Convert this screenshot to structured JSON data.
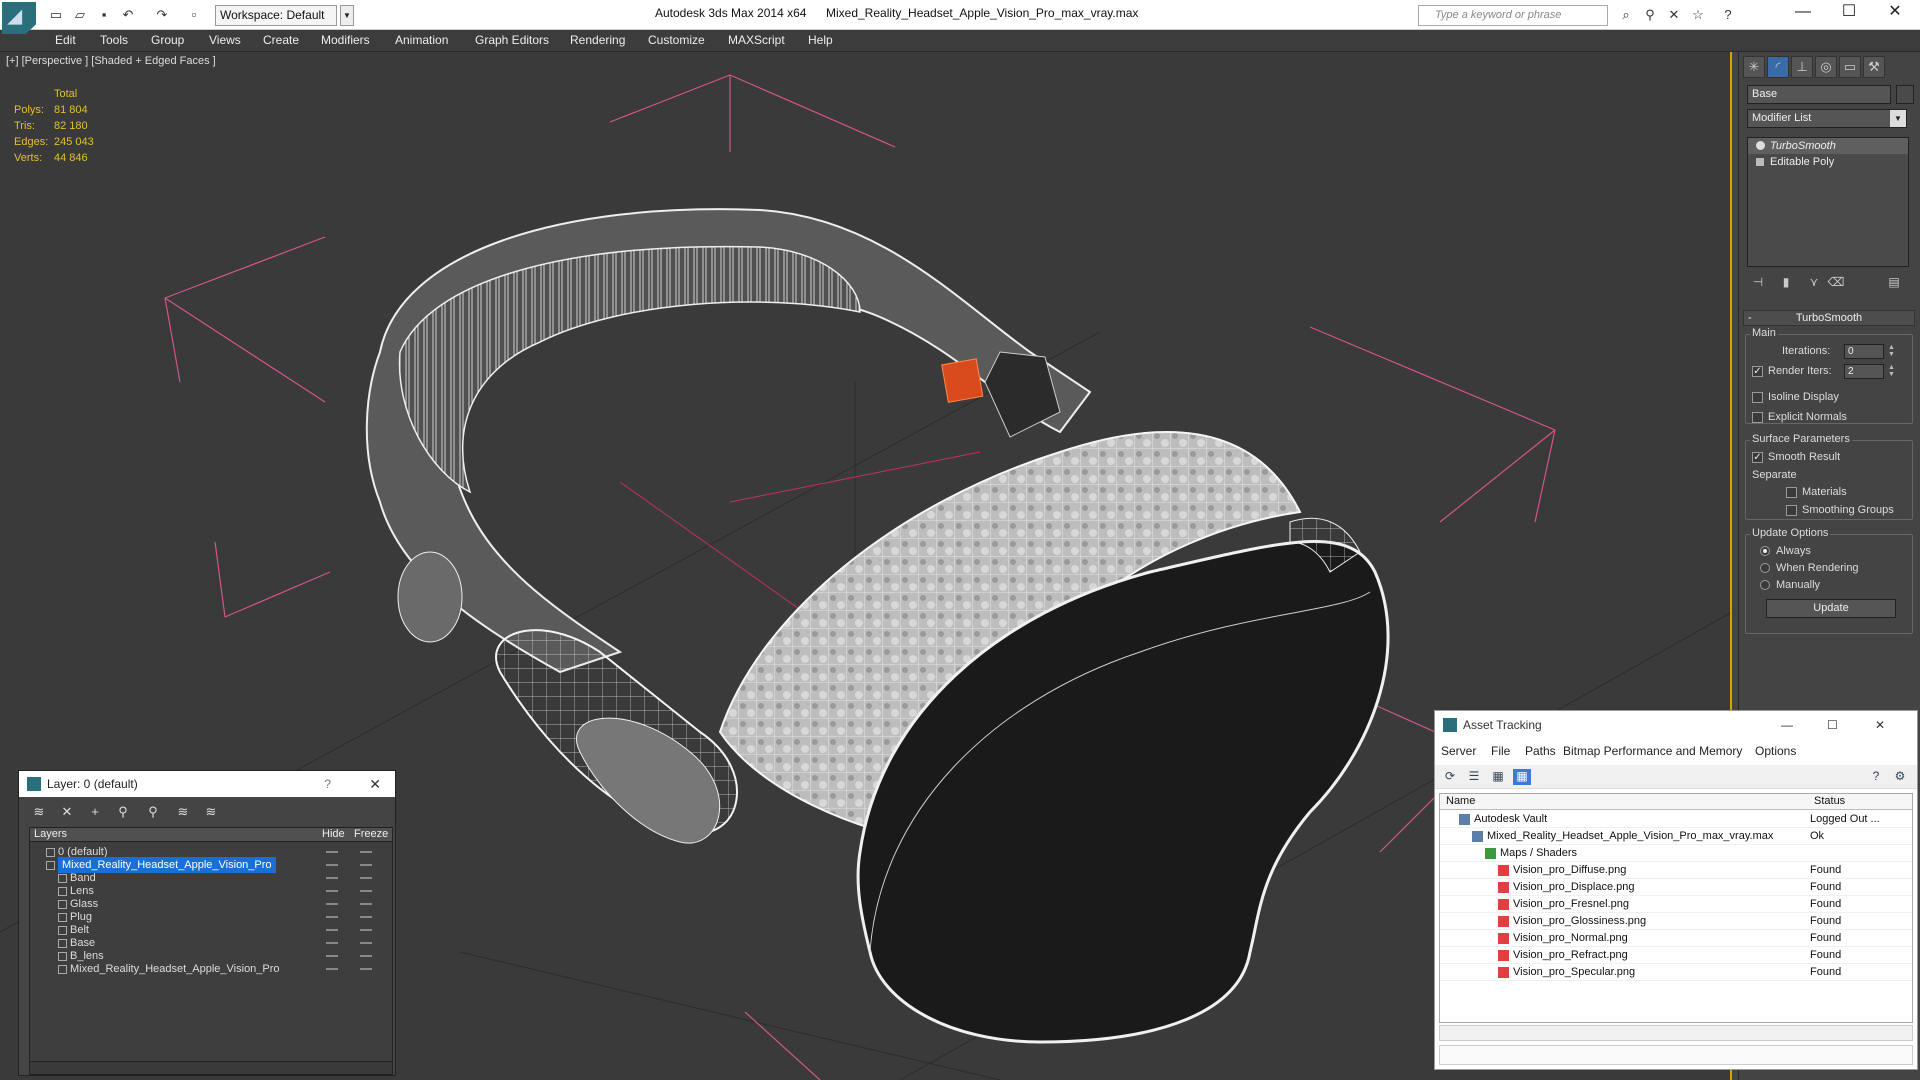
{
  "titlebar": {
    "workspace": "Workspace: Default",
    "app_title": "Autodesk 3ds Max  2014 x64",
    "doc_title": "Mixed_Reality_Headset_Apple_Vision_Pro_max_vray.max",
    "search_placeholder": "Type a keyword or phrase"
  },
  "menu": [
    "Edit",
    "Tools",
    "Group",
    "Views",
    "Create",
    "Modifiers",
    "Animation",
    "Graph Editors",
    "Rendering",
    "Customize",
    "MAXScript",
    "Help"
  ],
  "viewport": {
    "label": "[+] [Perspective ] [Shaded + Edged Faces ]",
    "stats_header": "Total",
    "stats": [
      {
        "label": "Polys:",
        "value": "81 804"
      },
      {
        "label": "Tris:",
        "value": "82 180"
      },
      {
        "label": "Edges:",
        "value": "245 043"
      },
      {
        "label": "Verts:",
        "value": "44 846"
      }
    ]
  },
  "command_panel": {
    "object_name": "Base",
    "modifier_list": "Modifier List",
    "stack": [
      {
        "label": "TurboSmooth",
        "selected": true
      },
      {
        "label": "Editable Poly",
        "selected": false
      }
    ],
    "rollout_title": "TurboSmooth",
    "main_group": "Main",
    "iterations_label": "Iterations:",
    "iterations_value": "0",
    "render_iters_label": "Render Iters:",
    "render_iters_value": "2",
    "isoline_label": "Isoline Display",
    "explicit_normals_label": "Explicit Normals",
    "surface_group": "Surface Parameters",
    "smooth_result_label": "Smooth Result",
    "separate_label": "Separate",
    "materials_label": "Materials",
    "smoothing_groups_label": "Smoothing Groups",
    "update_group": "Update Options",
    "always_label": "Always",
    "when_rendering_label": "When Rendering",
    "manually_label": "Manually",
    "update_button": "Update"
  },
  "layer_window": {
    "title": "Layer: 0 (default)",
    "col_layers": "Layers",
    "col_hide": "Hide",
    "col_freeze": "Freeze",
    "rows": [
      {
        "name": "0 (default)",
        "indent": 1,
        "kind": "layer"
      },
      {
        "name": "Mixed_Reality_Headset_Apple_Vision_Pro",
        "indent": 1,
        "kind": "layer",
        "selected": true
      },
      {
        "name": "Band",
        "indent": 2,
        "kind": "object"
      },
      {
        "name": "Lens",
        "indent": 2,
        "kind": "object"
      },
      {
        "name": "Glass",
        "indent": 2,
        "kind": "object"
      },
      {
        "name": "Plug",
        "indent": 2,
        "kind": "object"
      },
      {
        "name": "Belt",
        "indent": 2,
        "kind": "object"
      },
      {
        "name": "Base",
        "indent": 2,
        "kind": "object"
      },
      {
        "name": "B_lens",
        "indent": 2,
        "kind": "object"
      },
      {
        "name": "Mixed_Reality_Headset_Apple_Vision_Pro",
        "indent": 2,
        "kind": "object"
      }
    ]
  },
  "asset_window": {
    "title": "Asset Tracking",
    "menu": [
      "Server",
      "File",
      "Paths",
      "Bitmap Performance and Memory",
      "Options"
    ],
    "col_name": "Name",
    "col_status": "Status",
    "rows": [
      {
        "name": "Autodesk Vault",
        "status": "Logged Out ...",
        "indent": 1
      },
      {
        "name": "Mixed_Reality_Headset_Apple_Vision_Pro_max_vray.max",
        "status": "Ok",
        "indent": 2
      },
      {
        "name": "Maps / Shaders",
        "status": "",
        "indent": 3
      },
      {
        "name": "Vision_pro_Diffuse.png",
        "status": "Found",
        "indent": 4
      },
      {
        "name": "Vision_pro_Displace.png",
        "status": "Found",
        "indent": 4
      },
      {
        "name": "Vision_pro_Fresnel.png",
        "status": "Found",
        "indent": 4
      },
      {
        "name": "Vision_pro_Glossiness.png",
        "status": "Found",
        "indent": 4
      },
      {
        "name": "Vision_pro_Normal.png",
        "status": "Found",
        "indent": 4
      },
      {
        "name": "Vision_pro_Refract.png",
        "status": "Found",
        "indent": 4
      },
      {
        "name": "Vision_pro_Specular.png",
        "status": "Found",
        "indent": 4
      }
    ]
  },
  "colors": {
    "viewport_bg": "#3a3a3a",
    "stats": "#e0c030",
    "selection": "#1a6fd6",
    "bbox": "#d2558a"
  }
}
